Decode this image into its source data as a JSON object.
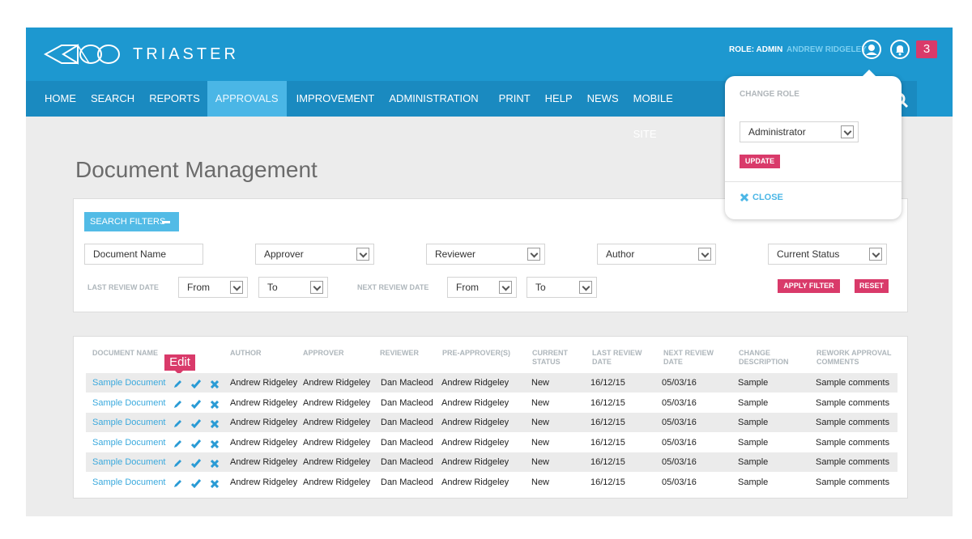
{
  "brand": {
    "name": "TRIASTER"
  },
  "header": {
    "role_label": "ROLE: ADMIN",
    "user_name": "ANDREW RIDGELEY",
    "notification_count": "3"
  },
  "nav": {
    "items": [
      {
        "label": "HOME"
      },
      {
        "label": "SEARCH"
      },
      {
        "label": "REPORTS"
      },
      {
        "label": "APPROVALS",
        "active": true
      },
      {
        "label": "IMPROVEMENT"
      },
      {
        "label": "ADMINISTRATION"
      },
      {
        "label": "PRINT"
      },
      {
        "label": "HELP"
      },
      {
        "label": "NEWS"
      },
      {
        "label": "MOBILE SITE"
      }
    ]
  },
  "page": {
    "title": "Document Management"
  },
  "filters": {
    "toggle_label": "SEARCH FILTERS",
    "document_name": "Document Name",
    "approver": "Approver",
    "reviewer": "Reviewer",
    "author": "Author",
    "current_status": "Current Status",
    "last_review_label": "LAST REVIEW DATE",
    "next_review_label": "NEXT REVIEW DATE",
    "from": "From",
    "to": "To",
    "apply_label": "APPLY FILTER",
    "reset_label": "RESET"
  },
  "table": {
    "edit_tooltip": "Edit",
    "headers": {
      "document_name": "DOCUMENT NAME",
      "author": "AUTHOR",
      "approver": "APPROVER",
      "reviewer": "REVIEWER",
      "pre_approver": "PRE-APPROVER(S)",
      "current_status_1": "CURRENT",
      "current_status_2": "STATUS",
      "last_review_1": "LAST REVIEW",
      "last_review_2": "DATE",
      "next_review_1": "NEXT REVIEW",
      "next_review_2": "DATE",
      "change_desc_1": "CHANGE",
      "change_desc_2": "DESCRIPTION",
      "rework_1": "REWORK APPROVAL",
      "rework_2": "COMMENTS"
    },
    "rows": [
      {
        "doc": "Sample Document",
        "author": "Andrew Ridgeley",
        "approver": "Andrew Ridgeley",
        "reviewer": "Dan Macleod",
        "pre": "Andrew Ridgeley",
        "status": "New",
        "last": "16/12/15",
        "next": "05/03/16",
        "change": "Sample",
        "rework": "Sample comments"
      },
      {
        "doc": "Sample Document",
        "author": "Andrew Ridgeley",
        "approver": "Andrew Ridgeley",
        "reviewer": "Dan Macleod",
        "pre": "Andrew Ridgeley",
        "status": "New",
        "last": "16/12/15",
        "next": "05/03/16",
        "change": "Sample",
        "rework": "Sample comments"
      },
      {
        "doc": "Sample Document",
        "author": "Andrew Ridgeley",
        "approver": "Andrew Ridgeley",
        "reviewer": "Dan Macleod",
        "pre": "Andrew Ridgeley",
        "status": "New",
        "last": "16/12/15",
        "next": "05/03/16",
        "change": "Sample",
        "rework": "Sample comments"
      },
      {
        "doc": "Sample Document",
        "author": "Andrew Ridgeley",
        "approver": "Andrew Ridgeley",
        "reviewer": "Dan Macleod",
        "pre": "Andrew Ridgeley",
        "status": "New",
        "last": "16/12/15",
        "next": "05/03/16",
        "change": "Sample",
        "rework": "Sample comments"
      },
      {
        "doc": "Sample Document",
        "author": "Andrew Ridgeley",
        "approver": "Andrew Ridgeley",
        "reviewer": "Dan Macleod",
        "pre": "Andrew Ridgeley",
        "status": "New",
        "last": "16/12/15",
        "next": "05/03/16",
        "change": "Sample",
        "rework": "Sample comments"
      },
      {
        "doc": "Sample Document",
        "author": "Andrew Ridgeley",
        "approver": "Andrew Ridgeley",
        "reviewer": "Dan Macleod",
        "pre": "Andrew Ridgeley",
        "status": "New",
        "last": "16/12/15",
        "next": "05/03/16",
        "change": "Sample",
        "rework": "Sample comments"
      }
    ]
  },
  "popover": {
    "title": "CHANGE ROLE",
    "selected_role": "Administrator",
    "update_label": "UPDATE",
    "close_label": "CLOSE"
  },
  "colors": {
    "brand_blue": "#1d98d0",
    "nav_blue": "#1a8ac0",
    "active_tab": "#4ab6e6",
    "accent_pink": "#d93a6a",
    "link_blue": "#3aa9dd"
  },
  "icons": {
    "logo": "triaster-logo",
    "user": "user-icon",
    "notifications": "bell-icon",
    "search": "search-icon",
    "edit": "pencil-icon",
    "approve": "check-icon",
    "reject": "cross-icon",
    "close": "close-icon"
  }
}
